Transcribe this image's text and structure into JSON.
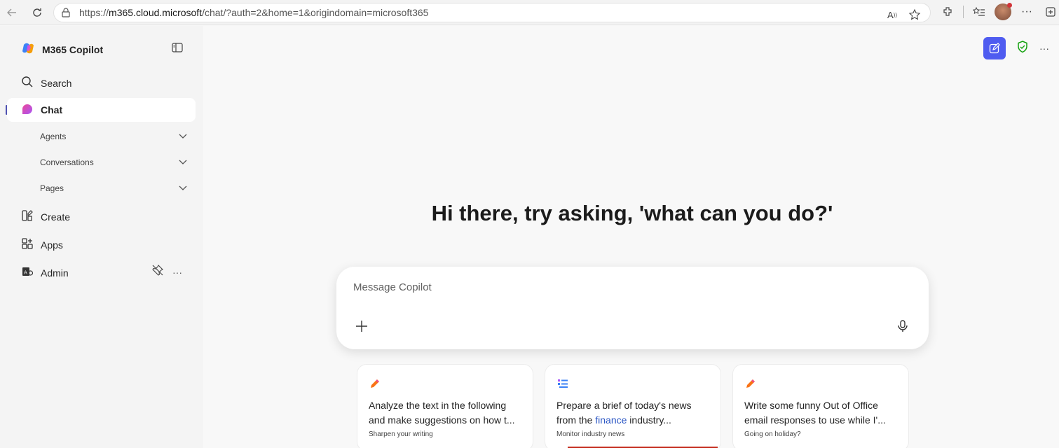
{
  "browser": {
    "url_prefix": "https://",
    "url_host": "m365.cloud.microsoft",
    "url_rest": "/chat/?auth=2&home=1&origindomain=microsoft365"
  },
  "sidebar": {
    "brand": "M365 Copilot",
    "items": {
      "search": "Search",
      "chat": "Chat",
      "agents": "Agents",
      "conversations": "Conversations",
      "pages": "Pages",
      "create": "Create",
      "apps": "Apps",
      "admin": "Admin"
    }
  },
  "main": {
    "greeting": "Hi there, try asking, 'what can you do?'",
    "composer_placeholder": "Message Copilot",
    "cards": [
      {
        "line1": "Analyze the text in the following",
        "line2": "and make suggestions on how t...",
        "tag": "Sharpen your writing",
        "icon": "pencil-icon"
      },
      {
        "line1": "Prepare a brief of today's news",
        "line2_pre": "from the ",
        "line2_hl": "finance",
        "line2_post": " industry...",
        "tag": "Monitor industry news",
        "icon": "list-icon"
      },
      {
        "line1": "Write some funny Out of Office",
        "line2": "email responses to use while I'...",
        "tag": "Going on holiday?",
        "icon": "pencil-icon"
      }
    ]
  },
  "colors": {
    "accent": "#4f5cf0",
    "highlight": "#2b56c4",
    "active_indicator": "#4f52b2"
  }
}
